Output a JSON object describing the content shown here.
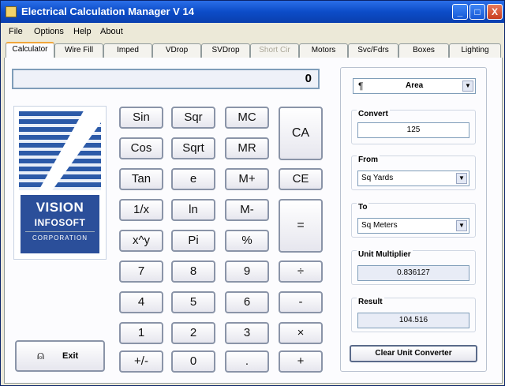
{
  "window": {
    "title": "Electrical Calculation Manager V 14",
    "minimize": "_",
    "maximize": "□",
    "close": "X"
  },
  "menu": [
    "File",
    "Options",
    "Help",
    "About"
  ],
  "tabs": [
    "Calculator",
    "Wire Fill",
    "Imped",
    "VDrop",
    "SVDrop",
    "Short Cir",
    "Motors",
    "Svc/Fdrs",
    "Boxes",
    "Lighting"
  ],
  "active_tab": "Calculator",
  "disabled_tab": "Short Cir",
  "display": {
    "value": "0"
  },
  "logo": {
    "line1": "VISION",
    "line2": "INFOSOFT",
    "line3": "CORPORATION"
  },
  "keys": {
    "sin": "Sin",
    "sqr": "Sqr",
    "mc": "MC",
    "ca": "CA",
    "cos": "Cos",
    "sqrt": "Sqrt",
    "mr": "MR",
    "tan": "Tan",
    "e": "e",
    "mplus": "M+",
    "ce": "CE",
    "recip": "1/x",
    "ln": "ln",
    "mminus": "M-",
    "equals": "=",
    "pow": "x^y",
    "pi": "Pi",
    "percent": "%",
    "d7": "7",
    "d8": "8",
    "d9": "9",
    "div": "÷",
    "d4": "4",
    "d5": "5",
    "d6": "6",
    "minus": "-",
    "d1": "1",
    "d2": "2",
    "d3": "3",
    "mul": "×",
    "sign": "+/-",
    "d0": "0",
    "dot": ".",
    "plus": "+"
  },
  "exit": {
    "label": "Exit",
    "icon": "exit-door-icon"
  },
  "converter": {
    "category": "Area",
    "convert_label": "Convert",
    "convert_value": "125",
    "from_label": "From",
    "from_value": "Sq Yards",
    "to_label": "To",
    "to_value": "Sq Meters",
    "multiplier_label": "Unit Multiplier",
    "multiplier_value": "0.836127",
    "result_label": "Result",
    "result_value": "104.516",
    "clear_label": "Clear Unit Converter"
  },
  "colors": {
    "titlebar": "#0c4cc8",
    "tab_accent": "#f1a63a",
    "logo_blue": "#2b4f9a"
  }
}
